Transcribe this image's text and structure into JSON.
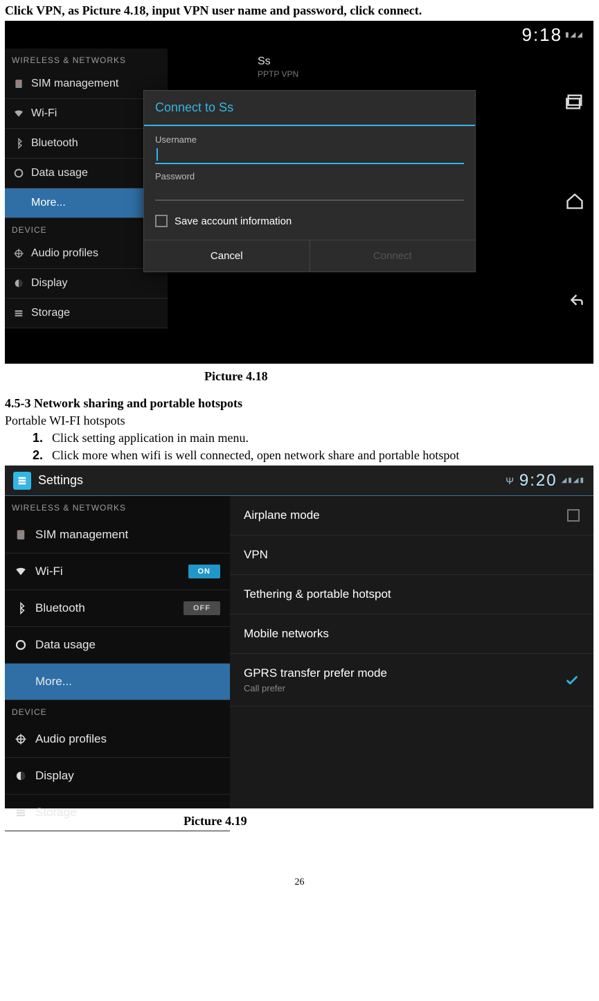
{
  "instruction": "Click VPN, as Picture 4.18, input VPN user name and password, click connect.",
  "caption1": "Picture 4.18",
  "section_heading": "4.5-3 Network sharing and portable hotspots",
  "subheading": "Portable WI-FI hotspots",
  "steps": [
    "Click setting application in main menu.",
    "Click more when wifi is well connected, open network share and portable hotspot"
  ],
  "caption2": "Picture 4.19",
  "page_number": "26",
  "shot1": {
    "status_time": "9:18",
    "sidebar": {
      "section1": "WIRELESS & NETWORKS",
      "items1": [
        "SIM management",
        "Wi-Fi",
        "Bluetooth",
        "Data usage",
        "More..."
      ],
      "section2": "DEVICE",
      "items2": [
        "Audio profiles",
        "Display",
        "Storage"
      ]
    },
    "vpn": {
      "name": "Ss",
      "type": "PPTP VPN"
    },
    "dialog": {
      "title": "Connect to Ss",
      "username_label": "Username",
      "password_label": "Password",
      "save_label": "Save account information",
      "cancel": "Cancel",
      "connect": "Connect"
    }
  },
  "shot2": {
    "app_title": "Settings",
    "status_time": "9:20",
    "sidebar": {
      "section1": "WIRELESS & NETWORKS",
      "items": [
        {
          "label": "SIM management"
        },
        {
          "label": "Wi-Fi",
          "switch": "ON"
        },
        {
          "label": "Bluetooth",
          "switch": "OFF"
        },
        {
          "label": "Data usage"
        },
        {
          "label": "More...",
          "selected": true
        }
      ],
      "section2": "DEVICE",
      "items2": [
        "Audio profiles",
        "Display",
        "Storage"
      ]
    },
    "options": {
      "airplane": "Airplane mode",
      "vpn": "VPN",
      "tether": "Tethering & portable hotspot",
      "mobile": "Mobile networks",
      "gprs": "GPRS transfer prefer mode",
      "gprs_sub": "Call prefer"
    }
  }
}
